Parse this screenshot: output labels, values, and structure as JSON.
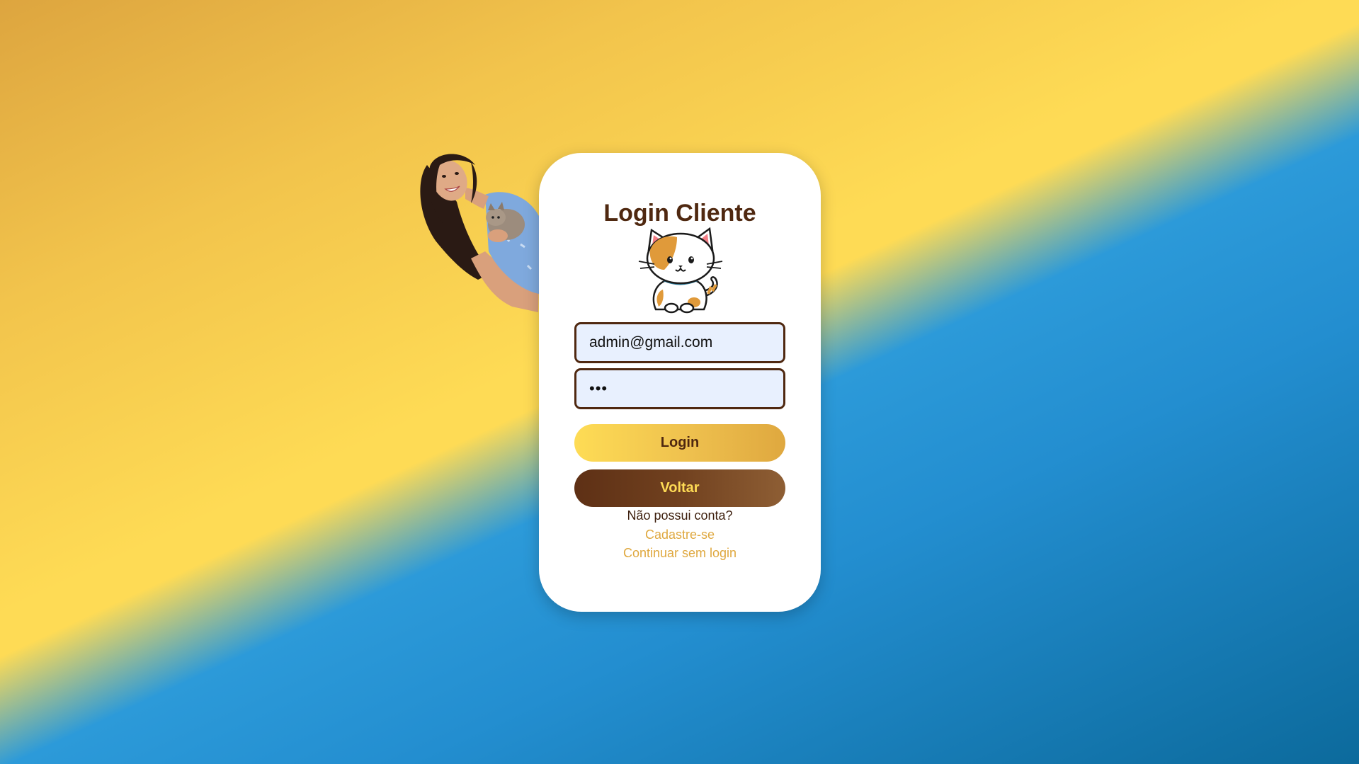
{
  "login_card": {
    "title": "Login Cliente",
    "email_value": "admin@gmail.com",
    "password_value": "•••",
    "login_button_label": "Login",
    "back_button_label": "Voltar",
    "no_account_text": "Não possui conta?",
    "register_link_text": "Cadastre-se",
    "continue_link_text": "Continuar sem login"
  },
  "colors": {
    "brown": "#4f2810",
    "gold": "#dfa83f",
    "yellow": "#fedb55",
    "blue": "#2c9ad9"
  },
  "illustrations": {
    "mascot": "cat-mascot-icon",
    "photo": "woman-holding-cat-photo"
  }
}
